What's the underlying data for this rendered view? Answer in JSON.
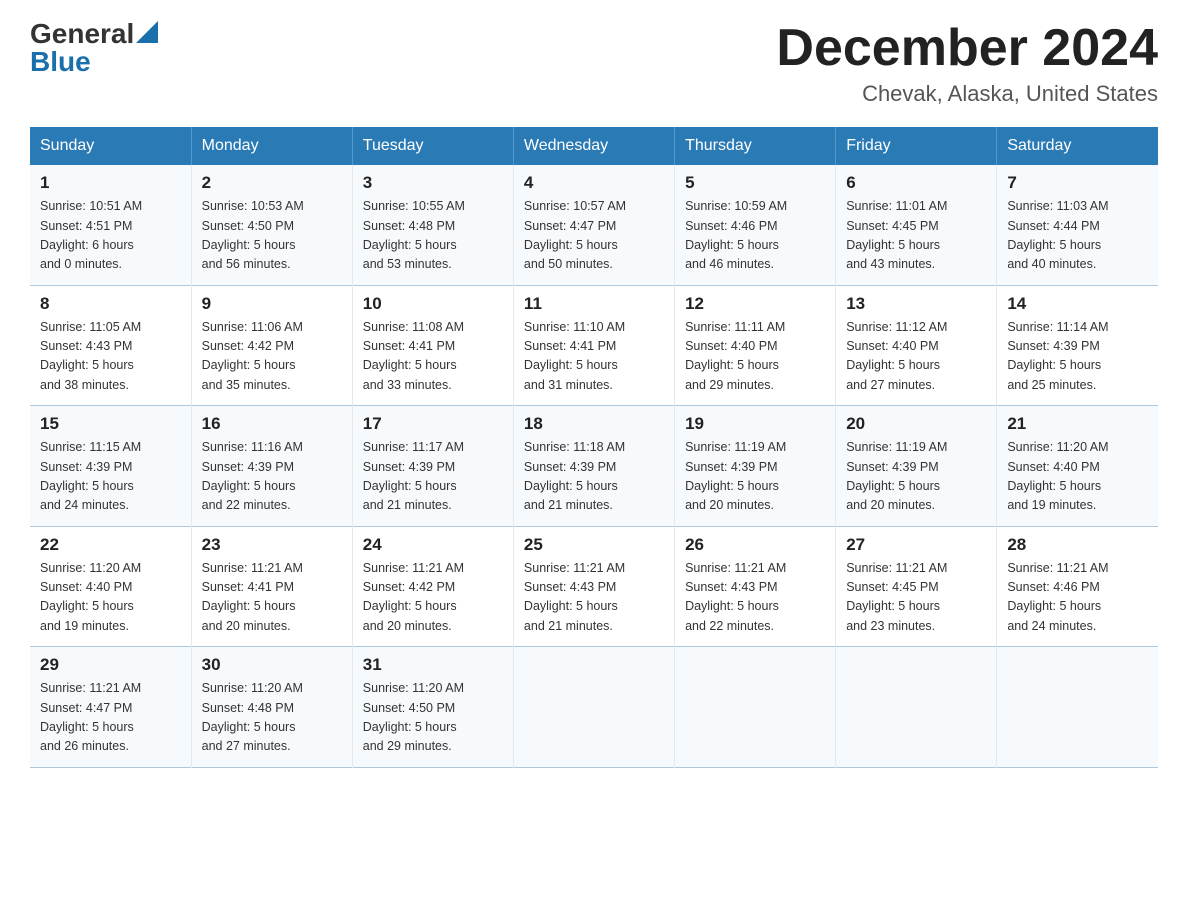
{
  "logo": {
    "general": "General",
    "blue": "Blue"
  },
  "title": "December 2024",
  "location": "Chevak, Alaska, United States",
  "days_of_week": [
    "Sunday",
    "Monday",
    "Tuesday",
    "Wednesday",
    "Thursday",
    "Friday",
    "Saturday"
  ],
  "weeks": [
    [
      {
        "day": "1",
        "sunrise": "Sunrise: 10:51 AM",
        "sunset": "Sunset: 4:51 PM",
        "daylight": "Daylight: 6 hours",
        "daylight2": "and 0 minutes."
      },
      {
        "day": "2",
        "sunrise": "Sunrise: 10:53 AM",
        "sunset": "Sunset: 4:50 PM",
        "daylight": "Daylight: 5 hours",
        "daylight2": "and 56 minutes."
      },
      {
        "day": "3",
        "sunrise": "Sunrise: 10:55 AM",
        "sunset": "Sunset: 4:48 PM",
        "daylight": "Daylight: 5 hours",
        "daylight2": "and 53 minutes."
      },
      {
        "day": "4",
        "sunrise": "Sunrise: 10:57 AM",
        "sunset": "Sunset: 4:47 PM",
        "daylight": "Daylight: 5 hours",
        "daylight2": "and 50 minutes."
      },
      {
        "day": "5",
        "sunrise": "Sunrise: 10:59 AM",
        "sunset": "Sunset: 4:46 PM",
        "daylight": "Daylight: 5 hours",
        "daylight2": "and 46 minutes."
      },
      {
        "day": "6",
        "sunrise": "Sunrise: 11:01 AM",
        "sunset": "Sunset: 4:45 PM",
        "daylight": "Daylight: 5 hours",
        "daylight2": "and 43 minutes."
      },
      {
        "day": "7",
        "sunrise": "Sunrise: 11:03 AM",
        "sunset": "Sunset: 4:44 PM",
        "daylight": "Daylight: 5 hours",
        "daylight2": "and 40 minutes."
      }
    ],
    [
      {
        "day": "8",
        "sunrise": "Sunrise: 11:05 AM",
        "sunset": "Sunset: 4:43 PM",
        "daylight": "Daylight: 5 hours",
        "daylight2": "and 38 minutes."
      },
      {
        "day": "9",
        "sunrise": "Sunrise: 11:06 AM",
        "sunset": "Sunset: 4:42 PM",
        "daylight": "Daylight: 5 hours",
        "daylight2": "and 35 minutes."
      },
      {
        "day": "10",
        "sunrise": "Sunrise: 11:08 AM",
        "sunset": "Sunset: 4:41 PM",
        "daylight": "Daylight: 5 hours",
        "daylight2": "and 33 minutes."
      },
      {
        "day": "11",
        "sunrise": "Sunrise: 11:10 AM",
        "sunset": "Sunset: 4:41 PM",
        "daylight": "Daylight: 5 hours",
        "daylight2": "and 31 minutes."
      },
      {
        "day": "12",
        "sunrise": "Sunrise: 11:11 AM",
        "sunset": "Sunset: 4:40 PM",
        "daylight": "Daylight: 5 hours",
        "daylight2": "and 29 minutes."
      },
      {
        "day": "13",
        "sunrise": "Sunrise: 11:12 AM",
        "sunset": "Sunset: 4:40 PM",
        "daylight": "Daylight: 5 hours",
        "daylight2": "and 27 minutes."
      },
      {
        "day": "14",
        "sunrise": "Sunrise: 11:14 AM",
        "sunset": "Sunset: 4:39 PM",
        "daylight": "Daylight: 5 hours",
        "daylight2": "and 25 minutes."
      }
    ],
    [
      {
        "day": "15",
        "sunrise": "Sunrise: 11:15 AM",
        "sunset": "Sunset: 4:39 PM",
        "daylight": "Daylight: 5 hours",
        "daylight2": "and 24 minutes."
      },
      {
        "day": "16",
        "sunrise": "Sunrise: 11:16 AM",
        "sunset": "Sunset: 4:39 PM",
        "daylight": "Daylight: 5 hours",
        "daylight2": "and 22 minutes."
      },
      {
        "day": "17",
        "sunrise": "Sunrise: 11:17 AM",
        "sunset": "Sunset: 4:39 PM",
        "daylight": "Daylight: 5 hours",
        "daylight2": "and 21 minutes."
      },
      {
        "day": "18",
        "sunrise": "Sunrise: 11:18 AM",
        "sunset": "Sunset: 4:39 PM",
        "daylight": "Daylight: 5 hours",
        "daylight2": "and 21 minutes."
      },
      {
        "day": "19",
        "sunrise": "Sunrise: 11:19 AM",
        "sunset": "Sunset: 4:39 PM",
        "daylight": "Daylight: 5 hours",
        "daylight2": "and 20 minutes."
      },
      {
        "day": "20",
        "sunrise": "Sunrise: 11:19 AM",
        "sunset": "Sunset: 4:39 PM",
        "daylight": "Daylight: 5 hours",
        "daylight2": "and 20 minutes."
      },
      {
        "day": "21",
        "sunrise": "Sunrise: 11:20 AM",
        "sunset": "Sunset: 4:40 PM",
        "daylight": "Daylight: 5 hours",
        "daylight2": "and 19 minutes."
      }
    ],
    [
      {
        "day": "22",
        "sunrise": "Sunrise: 11:20 AM",
        "sunset": "Sunset: 4:40 PM",
        "daylight": "Daylight: 5 hours",
        "daylight2": "and 19 minutes."
      },
      {
        "day": "23",
        "sunrise": "Sunrise: 11:21 AM",
        "sunset": "Sunset: 4:41 PM",
        "daylight": "Daylight: 5 hours",
        "daylight2": "and 20 minutes."
      },
      {
        "day": "24",
        "sunrise": "Sunrise: 11:21 AM",
        "sunset": "Sunset: 4:42 PM",
        "daylight": "Daylight: 5 hours",
        "daylight2": "and 20 minutes."
      },
      {
        "day": "25",
        "sunrise": "Sunrise: 11:21 AM",
        "sunset": "Sunset: 4:43 PM",
        "daylight": "Daylight: 5 hours",
        "daylight2": "and 21 minutes."
      },
      {
        "day": "26",
        "sunrise": "Sunrise: 11:21 AM",
        "sunset": "Sunset: 4:43 PM",
        "daylight": "Daylight: 5 hours",
        "daylight2": "and 22 minutes."
      },
      {
        "day": "27",
        "sunrise": "Sunrise: 11:21 AM",
        "sunset": "Sunset: 4:45 PM",
        "daylight": "Daylight: 5 hours",
        "daylight2": "and 23 minutes."
      },
      {
        "day": "28",
        "sunrise": "Sunrise: 11:21 AM",
        "sunset": "Sunset: 4:46 PM",
        "daylight": "Daylight: 5 hours",
        "daylight2": "and 24 minutes."
      }
    ],
    [
      {
        "day": "29",
        "sunrise": "Sunrise: 11:21 AM",
        "sunset": "Sunset: 4:47 PM",
        "daylight": "Daylight: 5 hours",
        "daylight2": "and 26 minutes."
      },
      {
        "day": "30",
        "sunrise": "Sunrise: 11:20 AM",
        "sunset": "Sunset: 4:48 PM",
        "daylight": "Daylight: 5 hours",
        "daylight2": "and 27 minutes."
      },
      {
        "day": "31",
        "sunrise": "Sunrise: 11:20 AM",
        "sunset": "Sunset: 4:50 PM",
        "daylight": "Daylight: 5 hours",
        "daylight2": "and 29 minutes."
      },
      {
        "day": "",
        "sunrise": "",
        "sunset": "",
        "daylight": "",
        "daylight2": ""
      },
      {
        "day": "",
        "sunrise": "",
        "sunset": "",
        "daylight": "",
        "daylight2": ""
      },
      {
        "day": "",
        "sunrise": "",
        "sunset": "",
        "daylight": "",
        "daylight2": ""
      },
      {
        "day": "",
        "sunrise": "",
        "sunset": "",
        "daylight": "",
        "daylight2": ""
      }
    ]
  ]
}
